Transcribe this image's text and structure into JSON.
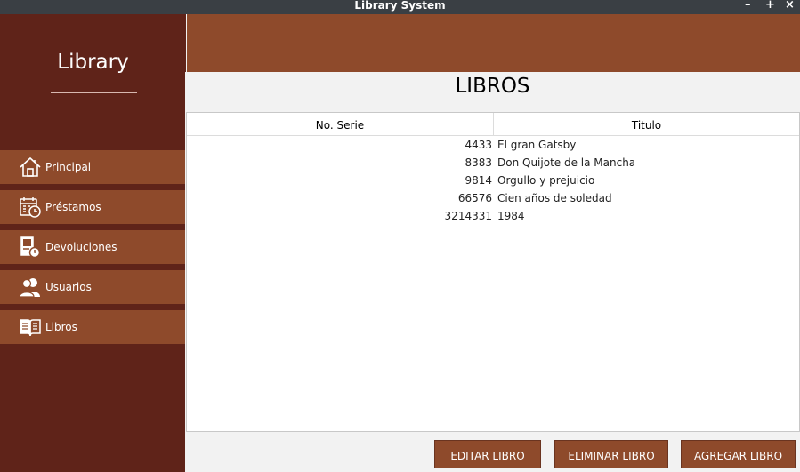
{
  "window": {
    "title": "Library System",
    "minimize": "–",
    "maximize": "+",
    "close": "×"
  },
  "sidebar": {
    "brand": "Library",
    "items": [
      {
        "label": "Principal",
        "icon": "home-icon"
      },
      {
        "label": "Préstamos",
        "icon": "calendar-clock-icon"
      },
      {
        "label": "Devoluciones",
        "icon": "return-document-icon"
      },
      {
        "label": "Usuarios",
        "icon": "users-icon"
      },
      {
        "label": "Libros",
        "icon": "book-icon",
        "active": true
      }
    ]
  },
  "main": {
    "title": "LIBROS",
    "table": {
      "headers": [
        "No. Serie",
        "Titulo"
      ],
      "rows": [
        [
          "4433",
          "El gran Gatsby"
        ],
        [
          "8383",
          "Don Quijote de la Mancha"
        ],
        [
          "9814",
          "Orgullo y prejuicio"
        ],
        [
          "66576",
          "Cien años de soledad"
        ],
        [
          "3214331",
          "1984"
        ]
      ]
    },
    "buttons": {
      "edit": "EDITAR LIBRO",
      "delete": "ELIMINAR LIBRO",
      "add": "AGREGAR LIBRO"
    }
  },
  "colors": {
    "sidebar": "#5f2319",
    "accent": "#8e4a2b",
    "titlebar": "#3a3f44"
  }
}
